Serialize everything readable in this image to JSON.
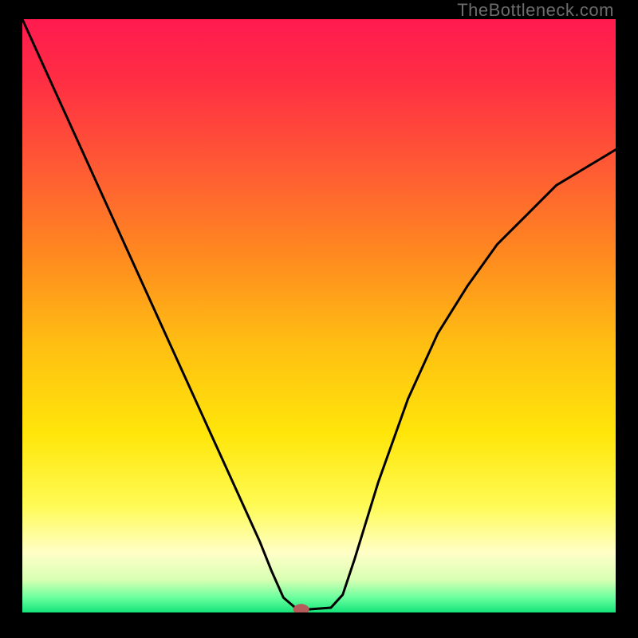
{
  "watermark": "TheBottleneck.com",
  "chart_data": {
    "type": "line",
    "title": "",
    "xlabel": "",
    "ylabel": "",
    "xlim": [
      0,
      100
    ],
    "ylim": [
      0,
      100
    ],
    "x": [
      0,
      5,
      10,
      15,
      20,
      25,
      30,
      35,
      40,
      42,
      44,
      46,
      47,
      48,
      52,
      54,
      56,
      60,
      65,
      70,
      75,
      80,
      85,
      90,
      95,
      100
    ],
    "values": [
      100,
      89,
      78,
      67,
      56,
      45,
      34,
      23,
      12,
      7,
      2.5,
      0.8,
      0.5,
      0.5,
      0.8,
      3,
      9,
      22,
      36,
      47,
      55,
      62,
      67,
      72,
      75,
      78
    ],
    "marker": {
      "x": 47,
      "y": 0.5
    },
    "gradient_stops": [
      {
        "pos": 0.0,
        "color": "#ff1a4f"
      },
      {
        "pos": 0.1,
        "color": "#ff2d44"
      },
      {
        "pos": 0.25,
        "color": "#ff5a34"
      },
      {
        "pos": 0.4,
        "color": "#ff8a1f"
      },
      {
        "pos": 0.55,
        "color": "#ffbf12"
      },
      {
        "pos": 0.7,
        "color": "#ffe60a"
      },
      {
        "pos": 0.82,
        "color": "#fffb55"
      },
      {
        "pos": 0.9,
        "color": "#ffffc8"
      },
      {
        "pos": 0.945,
        "color": "#d8ffb3"
      },
      {
        "pos": 0.975,
        "color": "#6bff9e"
      },
      {
        "pos": 1.0,
        "color": "#14e47a"
      }
    ],
    "line_color": "#000000",
    "marker_color": "#b55a5a"
  }
}
